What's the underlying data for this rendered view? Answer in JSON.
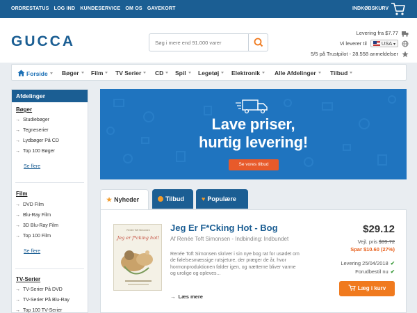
{
  "topbar": {
    "links": [
      "ORDRESTATUS",
      "LOG IND",
      "KUNDESERVICE",
      "OM OS",
      "GAVEKORT"
    ],
    "cart_label": "INDKØBSKURV"
  },
  "header": {
    "logo_text": "GUCCA",
    "search_placeholder": "Søg i mere end 91.000 varer",
    "delivery_from": "Levering fra $7.77",
    "ship_to_label": "Vi leverer til",
    "currency": "USA",
    "trustpilot": "5/5 på Trustpilot - 28.558 anmeldelser"
  },
  "nav": {
    "items": [
      "Forside",
      "Bøger",
      "Film",
      "TV Serier",
      "CD",
      "Spil",
      "Legetøj",
      "Elektronik",
      "Alle Afdelinger",
      "Tilbud"
    ]
  },
  "sidebar": {
    "title": "Afdelinger",
    "categories": [
      {
        "name": "Bøger",
        "items": [
          "Studiebøger",
          "Tegneserier",
          "Lydbøger På CD",
          "Top 100 Bøger"
        ],
        "more": "Se flere"
      },
      {
        "name": "Film",
        "items": [
          "DVD Film",
          "Blu-Ray Film",
          "3D Blu-Ray Film",
          "Top 100 Film"
        ],
        "more": "Se flere"
      },
      {
        "name": "TV-Serier",
        "items": [
          "TV-Serier På DVD",
          "TV-Serier På Blu-Ray",
          "Top 100 TV-Serier"
        ]
      }
    ]
  },
  "banner": {
    "line1": "Lave priser,",
    "line2": "hurtig levering!",
    "button": "Se vores tilbud"
  },
  "tabs": [
    {
      "label": "Nyheder",
      "active": true
    },
    {
      "label": "Tilbud",
      "active": false
    },
    {
      "label": "Populære",
      "active": false
    }
  ],
  "product": {
    "title": "Jeg Er F*Cking Hot - Bog",
    "author": "Af Renée Toft Simonsen - Indbinding: Indbundet",
    "description": "Renée Toft Simonsen skriver i sin nye bog rat for usødet om de følelsesmæssige rutsjeture, der præger de år, hvor hormonproduktionen falder igen, og nætterne bliver varme og urolige og opleves...",
    "more": "Læs mere",
    "price": "$29.12",
    "ref_label": "Vejl. pris",
    "ref_price": "$39.72",
    "save": "Spar $10.60 (27%)",
    "delivery": "Levering 25/04/2018",
    "preorder": "Forudbestil nu",
    "cart_button": "Læg i kurv",
    "cover_title": "Jeg er f*cking hot!",
    "cover_author": "Renée Toft Simonsen"
  },
  "colors": {
    "brand_blue": "#1b5e93",
    "accent_orange": "#f07a1e",
    "banner_blue": "#1f74bf"
  }
}
